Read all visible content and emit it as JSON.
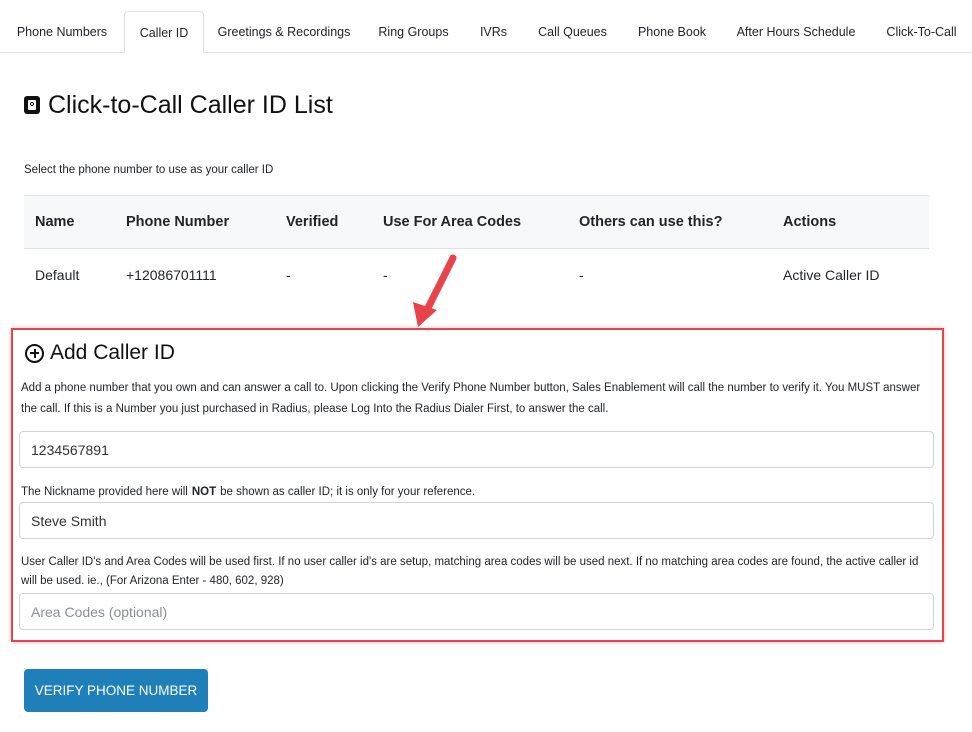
{
  "tabs": [
    {
      "label": "Phone Numbers"
    },
    {
      "label": "Caller ID"
    },
    {
      "label": "Greetings & Recordings"
    },
    {
      "label": "Ring Groups"
    },
    {
      "label": "IVRs"
    },
    {
      "label": "Call Queues"
    },
    {
      "label": "Phone Book"
    },
    {
      "label": "After Hours Schedule"
    },
    {
      "label": "Click-To-Call"
    }
  ],
  "page": {
    "title": "Click-to-Call Caller ID List",
    "subtitle": "Select the phone number to use as your caller ID"
  },
  "table": {
    "headers": [
      "Name",
      "Phone Number",
      "Verified",
      "Use For Area Codes",
      "Others can use this?",
      "Actions"
    ],
    "rows": [
      {
        "name": "Default",
        "phone": "+12086701111",
        "verified": "-",
        "area_codes": "-",
        "others": "-",
        "action": "Active Caller ID"
      }
    ]
  },
  "add": {
    "title": "Add Caller ID",
    "description": "Add a phone number that you own and can answer a call to. Upon clicking the Verify Phone Number button, Sales Enablement will call the number to verify it. You MUST answer the call. If this is a Number you just purchased in Radius, please Log Into the Radius Dialer First, to answer the call.",
    "phone_value": "1234567891",
    "nickname_note_pre": "The Nickname provided here will",
    "nickname_note_bold": "NOT",
    "nickname_note_post": "be shown as caller ID; it is only for your reference.",
    "nickname_value": "Steve Smith",
    "area_note": "User Caller ID's and Area Codes will be used first. If no user caller id's are setup, matching area codes will be used next. If no matching area codes are found, the active caller id will be used. ie., (For Arizona Enter - 480, 602, 928)",
    "area_placeholder": "Area Codes (optional)"
  },
  "verify_button": "VERIFY PHONE NUMBER",
  "colors": {
    "highlight_border": "#e8434a",
    "button_bg": "#1f7fb8",
    "arrow": "#e8434a"
  }
}
